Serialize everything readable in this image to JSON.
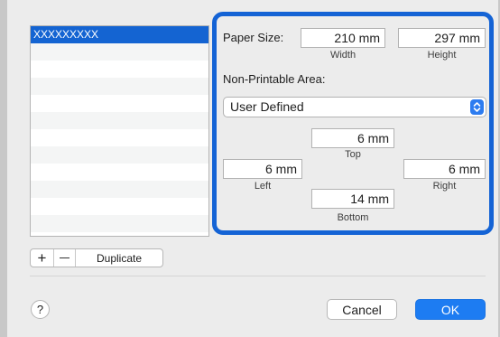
{
  "list": {
    "items": [
      "XXXXXXXXX",
      "",
      "",
      "",
      "",
      "",
      "",
      "",
      "",
      "",
      "",
      ""
    ]
  },
  "buttons": {
    "add": "+",
    "duplicate": "Duplicate",
    "help": "?",
    "cancel": "Cancel",
    "ok": "OK"
  },
  "paper_size": {
    "label": "Paper Size:",
    "width_value": "210 mm",
    "width_caption": "Width",
    "height_value": "297 mm",
    "height_caption": "Height"
  },
  "non_printable": {
    "label": "Non-Printable Area:",
    "selected": "User Defined",
    "top_value": "6 mm",
    "top_caption": "Top",
    "left_value": "6 mm",
    "left_caption": "Left",
    "right_value": "6 mm",
    "right_caption": "Right",
    "bottom_value": "14 mm",
    "bottom_caption": "Bottom"
  },
  "colors": {
    "accent": "#1464d2",
    "ok_button": "#1d7cf2"
  },
  "icons": [
    "plus-icon",
    "minus-icon",
    "help-icon",
    "updown-chevron-icon"
  ]
}
